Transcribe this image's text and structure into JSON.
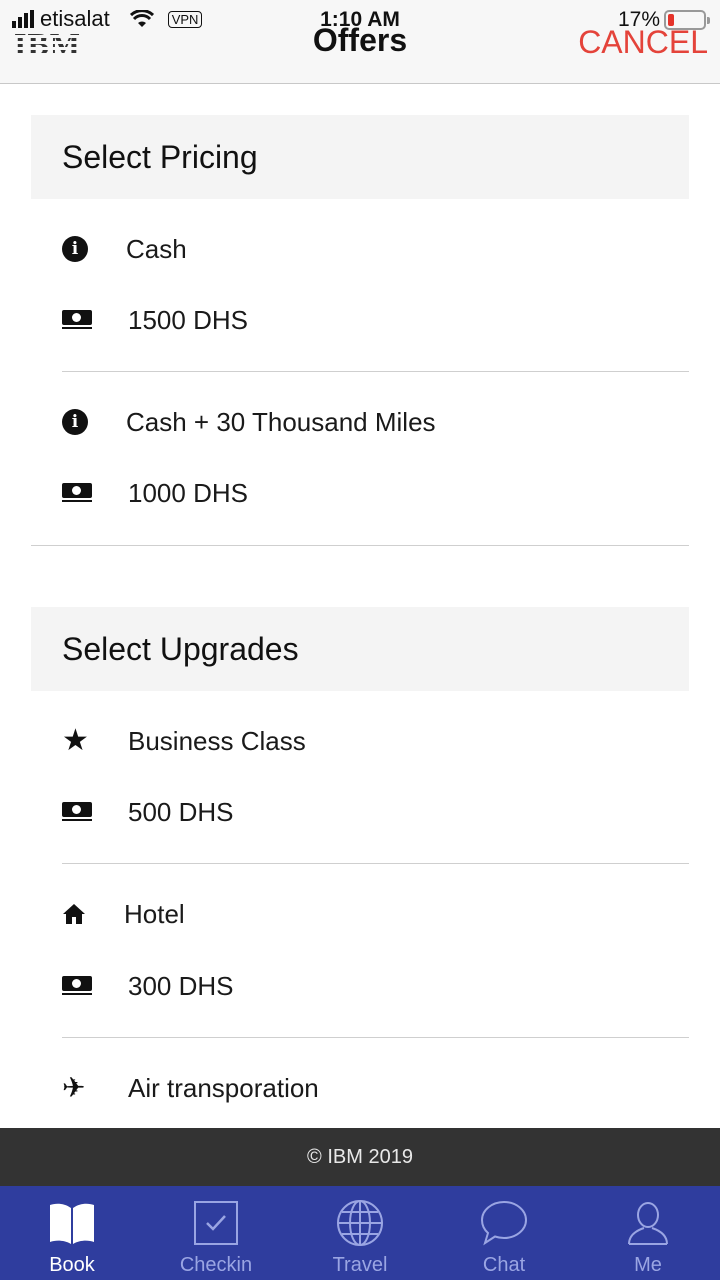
{
  "status_bar": {
    "carrier": "etisalat",
    "vpn": "VPN",
    "time": "1:10 AM",
    "battery": "17%",
    "battery_level": 0.17
  },
  "header": {
    "logo": "IBM",
    "title": "Offers",
    "cancel_label": "CANCEL"
  },
  "pricing": {
    "title": "Select Pricing",
    "options": [
      {
        "label": "Cash",
        "price": "1500 DHS"
      },
      {
        "label": "Cash + 30 Thousand Miles",
        "price": "1000 DHS"
      }
    ]
  },
  "upgrades": {
    "title": "Select Upgrades",
    "options": [
      {
        "label": "Business Class",
        "icon": "star-icon",
        "price": "500 DHS"
      },
      {
        "label": "Hotel",
        "icon": "home-icon",
        "price": "300 DHS"
      },
      {
        "label": "Air transporation",
        "icon": "airplane-icon"
      }
    ]
  },
  "footer": {
    "copyright": "© IBM 2019"
  },
  "tabs": [
    {
      "label": "Book",
      "icon": "book-icon",
      "active": true
    },
    {
      "label": "Checkin",
      "icon": "checkbox-icon",
      "active": false
    },
    {
      "label": "Travel",
      "icon": "globe-icon",
      "active": false
    },
    {
      "label": "Chat",
      "icon": "chat-bubble-icon",
      "active": false
    },
    {
      "label": "Me",
      "icon": "user-icon",
      "active": false
    }
  ],
  "colors": {
    "accent_cancel": "#e4433a",
    "tabbar_bg": "#2f3d9e",
    "footer_bg": "#333333",
    "section_bg": "#f4f4f4"
  }
}
